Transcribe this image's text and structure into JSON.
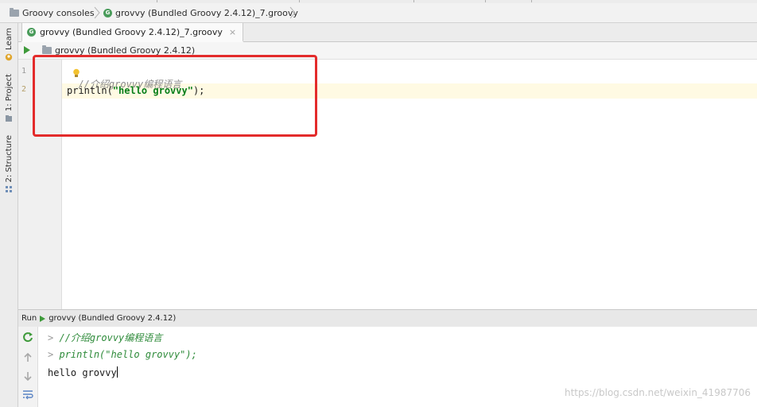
{
  "breadcrumb": {
    "items": [
      {
        "label": "Groovy consoles",
        "icon": "folder-icon"
      },
      {
        "label": "grovvy (Bundled Groovy 2.4.12)_7.groovy",
        "icon": "groovy-file-icon"
      }
    ]
  },
  "left_toolbar": {
    "tabs": [
      {
        "label": "Learn",
        "icon": "learn-icon"
      },
      {
        "label": "1: Project",
        "icon": "project-icon"
      },
      {
        "label": "2: Structure",
        "icon": "structure-icon"
      }
    ]
  },
  "editor_tab": {
    "label": "grovvy (Bundled Groovy 2.4.12)_7.groovy",
    "close_symbol": "×"
  },
  "console_toolbar": {
    "module_label": "grovvy (Bundled Groovy 2.4.12)"
  },
  "editor": {
    "line_numbers": [
      "1",
      "2"
    ],
    "lines": {
      "line1_comment": "//介绍grovvy编程语言",
      "line2_prefix": "println(",
      "line2_string": "\"hello grovvy\"",
      "line2_suffix": ");"
    }
  },
  "run_panel": {
    "run_label": "Run",
    "config_label": "grovvy (Bundled Groovy 2.4.12)",
    "prompt_symbol": ">",
    "output_lines": {
      "echo1": "//介绍grovvy编程语言",
      "echo2": "println(\"hello grovvy\");",
      "result": "hello grovvy"
    }
  },
  "watermark": "https://blog.csdn.net/weixin_41987706",
  "colors": {
    "highlight_box": "#e32b2b",
    "run_green": "#3e9a3a",
    "string_green": "#067d17",
    "comment_gray": "#8c8c8c",
    "caret_line": "#fffae3"
  }
}
